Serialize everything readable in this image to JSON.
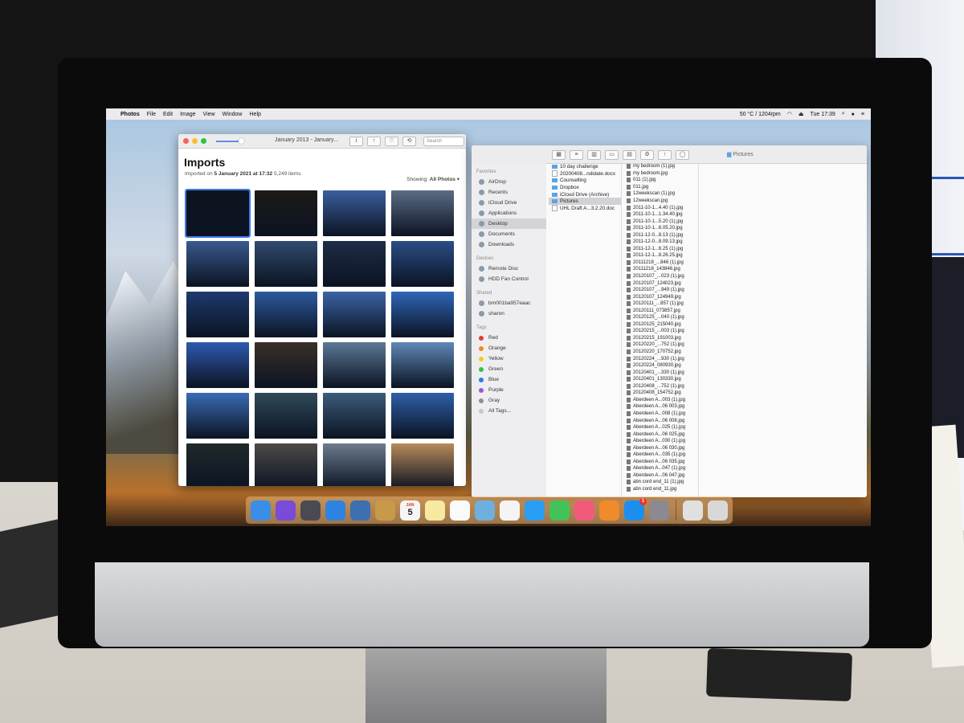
{
  "menubar": {
    "apple": "",
    "app": "Photos",
    "menus": [
      "File",
      "Edit",
      "Image",
      "View",
      "Window",
      "Help"
    ],
    "status": "50 °C / 1204rpm",
    "clock": "Tue 17:39"
  },
  "photos": {
    "window_title": "January 2013 - January...",
    "search_placeholder": "Search",
    "title": "Imports",
    "imported_on_label": "Imported on",
    "imported_on": "5 January 2021 at 17:32",
    "items_count": "5,249 items",
    "showing_label": "Showing:",
    "showing_value": "All Photos",
    "thumb_colors": [
      "#0f1320",
      "#1c1a17",
      "#3b5f9d",
      "#5c6c86",
      "#3a5a8e",
      "#314a6e",
      "#1e2c46",
      "#2a4e86",
      "#1e3a6e",
      "#2c5a9e",
      "#3c64a6",
      "#2f66b8",
      "#2e5ab0",
      "#3a3027",
      "#5c7896",
      "#5f88b8",
      "#3a6cb4",
      "#304a5a",
      "#3c5c7a",
      "#2f5fa8",
      "#1f2a2a",
      "#4e4a48",
      "#6d7c8e",
      "#b98a5a"
    ]
  },
  "finder": {
    "title": "Pictures",
    "sidebar": {
      "favorites_header": "Favorites",
      "favorites": [
        "AirDrop",
        "Recents",
        "iCloud Drive",
        "Applications",
        "Desktop",
        "Documents",
        "Downloads"
      ],
      "devices_header": "Devices",
      "devices": [
        "Remote Disc",
        "HDD Fan Control"
      ],
      "shared_header": "Shared",
      "shared": [
        "brn001ba957eaac",
        "sharon"
      ],
      "tags_header": "Tags",
      "tags": [
        "Red",
        "Orange",
        "Yellow",
        "Green",
        "Blue",
        "Purple",
        "Gray",
        "All Tags..."
      ],
      "tag_colors": [
        "#e23b3b",
        "#f08a1c",
        "#f2cd1e",
        "#3cbf4a",
        "#2f7be5",
        "#a057d1",
        "#8e8e93",
        "#c8c8c8"
      ]
    },
    "desktop_items": [
      "10 day challenge",
      "20200408...ndidate.docx",
      "Counselling",
      "Dropbox",
      "iCloud Drive (Archive)",
      "Pictures",
      "UHL Draft A...3.2.20.doc"
    ],
    "pictures_items": [
      "my bedroom (1).jpg",
      "my bedroom.jpg",
      "011 (1).jpg",
      "011.jpg",
      "12weekscan (1).jpg",
      "12weekscan.jpg",
      "2011-10-1...4.40 (1).jpg",
      "2011-10-1...1.34.40.jpg",
      "2011-10-1...5.20 (1).jpg",
      "2011-10-1...6.05.20.jpg",
      "2011-12-0...8.13 (1).jpg",
      "2011-12-0...8.09.13.jpg",
      "2011-12-1...6.25 (1).jpg",
      "2011-12-1...8.26.25.jpg",
      "20111218_...846 (1).jpg",
      "20111218_143846.jpg",
      "20120107_...023 (1).jpg",
      "20120107_124023.jpg",
      "20120107_...949 (1).jpg",
      "20120107_124949.jpg",
      "20120111_...857 (1).jpg",
      "20120111_073857.jpg",
      "20120125_...040 (1).jpg",
      "20120125_215040.jpg",
      "20120215_...003 (1).jpg",
      "20120215_191003.jpg",
      "20120220_...752 (1).jpg",
      "20120220_170752.jpg",
      "20120224_...930 (1).jpg",
      "20120224_080930.jpg",
      "20120401_...330 (1).jpg",
      "20120401_130330.jpg",
      "20120408_...752 (1).jpg",
      "20120408_154752.jpg",
      "Aberdeen A...003 (1).jpg",
      "Aberdeen A...06 003.jpg",
      "Aberdeen A...008 (1).jpg",
      "Aberdeen A...06 008.jpg",
      "Aberdeen A...025 (1).jpg",
      "Aberdeen A...06 025.jpg",
      "Aberdeen A...030 (1).jpg",
      "Aberdeen A...06 030.jpg",
      "Aberdeen A...035 (1).jpg",
      "Aberdeen A...06 035.jpg",
      "Aberdeen A...047 (1).jpg",
      "Aberdeen A...06 047.jpg",
      "abn cord end_11 (1).jpg",
      "abn cord end_11.jpg"
    ]
  },
  "dock": {
    "calendar_day": "5",
    "calendar_month": "JAN",
    "appstore_badge": "1",
    "icon_colors": [
      "#3a8ee6",
      "#7a4bd6",
      "#4a4a52",
      "#2f83e0",
      "#3e6fb0",
      "#c79a4a",
      "#f5f5f5",
      "#f7e9a0",
      "#fafafa",
      "#6db0e0",
      "#f4f4f4",
      "#2a9df4",
      "#42c35a",
      "#f25a7a",
      "#f08a2a",
      "#1c8ef0",
      "#8a8a90",
      "#e0e0e0",
      "#d8d8d8"
    ]
  }
}
